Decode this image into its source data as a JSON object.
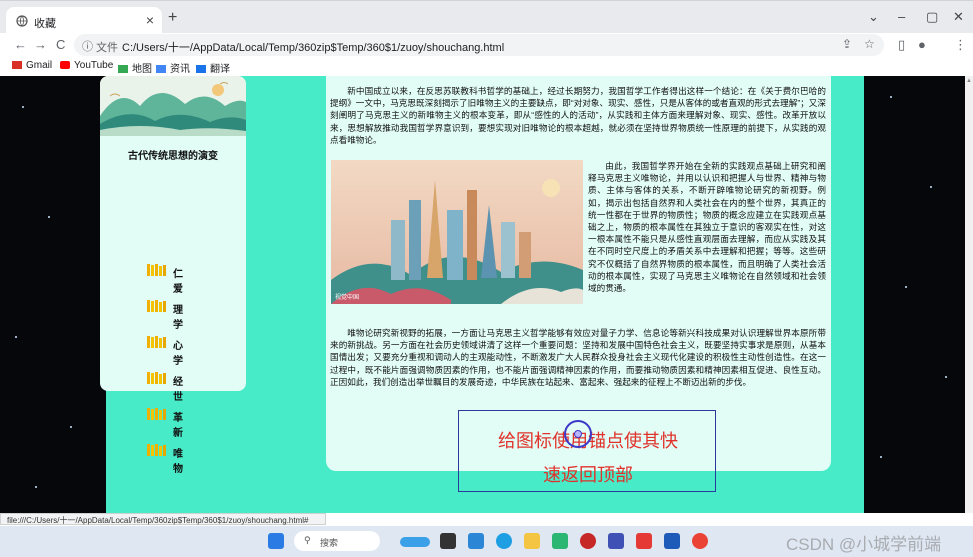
{
  "browser": {
    "tab_title": "收藏",
    "tab_close": "×",
    "new_tab": "+",
    "window_controls": [
      "⌄",
      "–",
      "▢",
      "✕"
    ],
    "nav": [
      "←",
      "→",
      "C"
    ],
    "url_label": "文件",
    "url": "C:/Users/十一/AppData/Local/Temp/360zip$Temp/360$1/zuoy/shouchang.html",
    "bookmarks": [
      "Gmail",
      "YouTube",
      "地图",
      "资讯",
      "翻译"
    ],
    "status_url": "file:///C:/Users/十一/AppData/Local/Temp/360zip$Temp/360$1/zuoy/shouchang.html#"
  },
  "sidebar": {
    "title": "古代传统思想的演变",
    "items": [
      "仁爱",
      "理学",
      "心学",
      "经世",
      "革新",
      "唯物"
    ]
  },
  "content": {
    "p1": "新中国成立以来，在反思苏联教科书哲学的基础上，经过长期努力，我国哲学工作者得出这样一个结论：在《关于费尔巴哈的提纲》一文中，马克思既深刻揭示了旧唯物主义的主要缺点，即“对对象、现实、感性，只是从客体的或者直观的形式去理解”；又深刻阐明了马克思主义的新唯物主义的根本变革，即从“感性的人的活动”，从实践和主体方面来理解对象、现实、感性。改革开放以来，思想解放推动我国哲学界意识到，要想实现对旧唯物论的根本超越，就必须在坚持世界物质统一性原理的前提下，从实践的观点看唯物论。",
    "p2": "由此，我国哲学界开始在全新的实践观点基础上研究和阐释马克思主义唯物论，并用以认识和把握人与世界、精神与物质、主体与客体的关系，不断开辟唯物论研究的新视野。例如，揭示出包括自然界和人类社会在内的整个世界，其真正的统一性都在于世界的物质性；物质的概念应建立在实践观点基础之上，物质的根本属性在其独立于意识的客观实在性，对这一根本属性不能只是从感性直观层面去理解，而应从实践及其在不同时空尺度上的矛盾关系中去理解和把握；等等。这些研究不仅概括了自然界物质的根本属性，而且明确了人类社会活动的根本属性，实现了马克思主义唯物论在自然领域和社会领域的贯通。",
    "p3": "唯物论研究新视野的拓展，一方面让马克思主义哲学能够有效应对量子力学、信息论等新兴科技成果对认识理解世界本原所带来的新挑战。另一方面在社会历史领域讲清了这样一个重要问题：坚持和发展中国特色社会主义，既要坚持实事求是原则，从基本国情出发；又要充分重视和调动人的主观能动性，不断激发广大人民群众投身社会主义现代化建设的积极性主动性创造性。在这一过程中，既不能片面强调物质因素的作用，也不能片面强调精神因素的作用，而要推动物质因素和精神因素相互促进、良性互动。正因如此，我们创造出举世瞩目的发展奇迹，中华民族在站起来、富起来、强起来的征程上不断迈出新的步伐。",
    "image_caption": "视觉中国"
  },
  "annotation": {
    "line1": "给图标使用锚点使其快",
    "line2": "速返回顶部"
  },
  "taskbar": {
    "search_placeholder": "搜索"
  },
  "watermark": "CSDN @小城学前端",
  "colors": {
    "page_bg": "#06070b",
    "container": "#48ebc8",
    "panel": "#e2fdf6",
    "annotation_text": "#e0322a",
    "annotation_border": "#2b3a9a"
  }
}
